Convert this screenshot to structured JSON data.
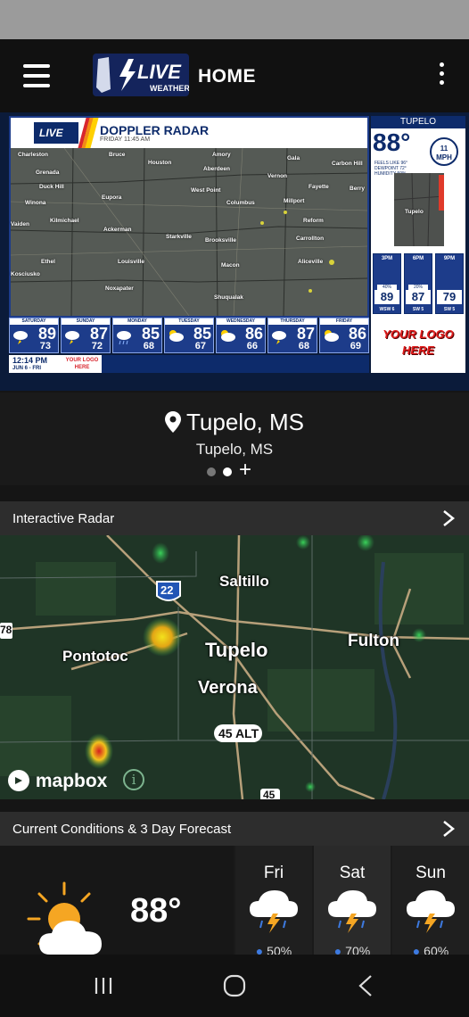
{
  "app": {
    "title": "HOME",
    "logo_text": "LIVE",
    "logo_sub": "WEATHER"
  },
  "broadcast": {
    "title": "DOPPLER RADAR",
    "subtitle": "FRIDAY 11:45 AM",
    "cities": [
      {
        "name": "Charleston"
      },
      {
        "name": "Bruce"
      },
      {
        "name": "Houston"
      },
      {
        "name": "Amory"
      },
      {
        "name": "Gala"
      },
      {
        "name": "Grenada"
      },
      {
        "name": "Aberdeen"
      },
      {
        "name": "Vernon"
      },
      {
        "name": "Carbon Hill"
      },
      {
        "name": "Duck Hill"
      },
      {
        "name": "Fayette"
      },
      {
        "name": "Berry"
      },
      {
        "name": "Winona"
      },
      {
        "name": "Eupora"
      },
      {
        "name": "West Point"
      },
      {
        "name": "Columbus"
      },
      {
        "name": "Millport"
      },
      {
        "name": "Kilmichael"
      },
      {
        "name": "Ackerman"
      },
      {
        "name": "Starkville"
      },
      {
        "name": "Reform"
      },
      {
        "name": "Vaiden"
      },
      {
        "name": "Brooksville"
      },
      {
        "name": "Carrollton"
      },
      {
        "name": "Ethel"
      },
      {
        "name": "Louisville"
      },
      {
        "name": "Macon"
      },
      {
        "name": "Aliceville"
      },
      {
        "name": "Kosciusko"
      },
      {
        "name": "Noxapater"
      },
      {
        "name": "Shuqualak"
      }
    ],
    "right": {
      "city": "TUPELO",
      "temp": "88°",
      "wind_speed": "11",
      "wind_unit": "MPH",
      "feels_line": "FEELS LIKE  96°",
      "dew_line": "DEWPOINT  72°",
      "hum_line": "HUMIDITY  59%",
      "mini_city": "Tupelo",
      "hours": [
        {
          "label": "3PM",
          "pct": "40%",
          "temp": "89",
          "wind": "WSW 6"
        },
        {
          "label": "6PM",
          "pct": "20%",
          "temp": "87",
          "wind": "SW 5"
        },
        {
          "label": "9PM",
          "pct": "",
          "temp": "79",
          "wind": "SW 5"
        }
      ],
      "logo_here": "YOUR LOGO HERE"
    },
    "days": [
      {
        "label": "SATURDAY",
        "hi": "89",
        "lo": "73"
      },
      {
        "label": "SUNDAY",
        "hi": "87",
        "lo": "72"
      },
      {
        "label": "MONDAY",
        "hi": "85",
        "lo": "68"
      },
      {
        "label": "TUESDAY",
        "hi": "85",
        "lo": "67"
      },
      {
        "label": "WEDNESDAY",
        "hi": "86",
        "lo": "66"
      },
      {
        "label": "THURSDAY",
        "hi": "87",
        "lo": "68"
      },
      {
        "label": "FRIDAY",
        "hi": "86",
        "lo": "69"
      }
    ],
    "time": "12:14 PM",
    "date": "JUN 6 - FRI",
    "small_logo": "YOUR LOGO HERE"
  },
  "location": {
    "primary": "Tupelo, MS",
    "secondary": "Tupelo, MS",
    "pages": 2,
    "active_page": 1
  },
  "radar": {
    "title": "Interactive Radar",
    "labels": [
      {
        "text": "Saltillo"
      },
      {
        "text": "Pontotoc"
      },
      {
        "text": "Tupelo"
      },
      {
        "text": "Fulton"
      },
      {
        "text": "Verona"
      },
      {
        "text": "22"
      },
      {
        "text": "45 ALT"
      },
      {
        "text": "45"
      },
      {
        "text": "78"
      }
    ],
    "attribution": "mapbox",
    "info_glyph": "i"
  },
  "conditions": {
    "title": "Current Conditions & 3 Day Forecast",
    "now_temp": "88°",
    "now_icon": "partly-cloudy-icon",
    "forecast": [
      {
        "day": "Fri",
        "pop": "50%",
        "icon": "thunderstorm-icon"
      },
      {
        "day": "Sat",
        "pop": "70%",
        "icon": "thunderstorm-icon"
      },
      {
        "day": "Sun",
        "pop": "60%",
        "icon": "thunderstorm-icon"
      }
    ]
  },
  "colors": {
    "accent_blue": "#1d3c8a",
    "logo_red": "#e01c1c",
    "sun_orange": "#f5a623",
    "rain_blue": "#3d7ae0"
  }
}
